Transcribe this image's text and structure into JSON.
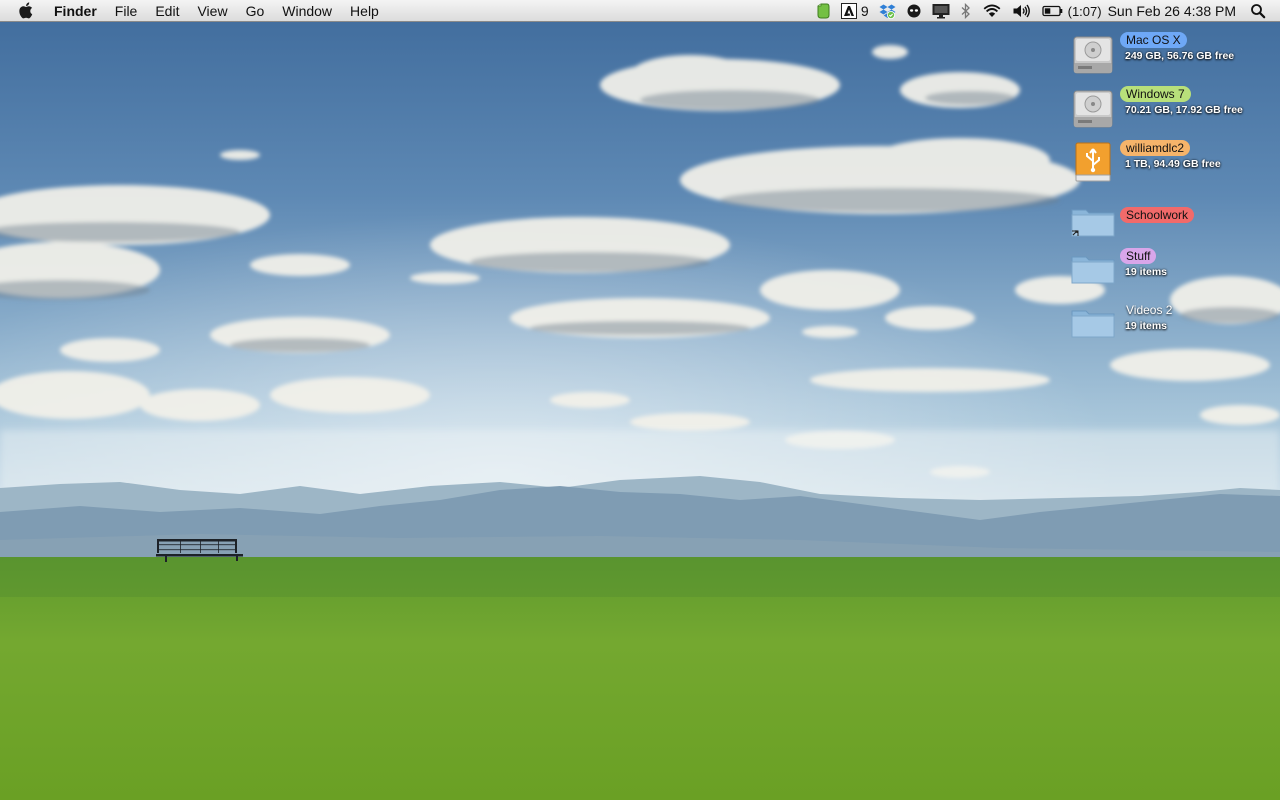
{
  "menubar": {
    "apple_icon": "apple-logo-icon",
    "app_name": "Finder",
    "menus": [
      "File",
      "Edit",
      "View",
      "Go",
      "Window",
      "Help"
    ],
    "status": {
      "evernote_icon": "evernote-icon",
      "adobe_icon": "adobe-updater-icon",
      "adobe_count": "9",
      "dropbox_icon": "dropbox-icon",
      "alien_icon": "alien-app-icon",
      "display_icon": "display-mirroring-icon",
      "bluetooth_icon": "bluetooth-icon",
      "wifi_icon": "wifi-icon",
      "volume_icon": "volume-icon",
      "battery_icon": "battery-icon",
      "battery_time": "(1:07)",
      "clock": "Sun Feb 26  4:38 PM",
      "spotlight_icon": "spotlight-search-icon"
    }
  },
  "desktop": {
    "icons": [
      {
        "name": "Mac OS X",
        "sub": "249 GB, 56.76 GB free",
        "kind": "hard-drive-icon",
        "label_color": "#6ea8f6"
      },
      {
        "name": "Windows 7",
        "sub": "70.21 GB, 17.92 GB free",
        "kind": "hard-drive-icon",
        "label_color": "#b8e07a"
      },
      {
        "name": "williamdlc2",
        "sub": "1 TB, 94.49 GB free",
        "kind": "usb-drive-icon",
        "label_color": "#f6b46a"
      },
      {
        "name": "Schoolwork",
        "sub": "",
        "kind": "folder-alias-icon",
        "label_color": "#f26a6a"
      },
      {
        "name": "Stuff",
        "sub": "19 items",
        "kind": "folder-icon",
        "label_color": "#d9a6ea"
      },
      {
        "name": "Videos 2",
        "sub": "19 items",
        "kind": "folder-icon",
        "label_color": ""
      }
    ]
  },
  "wallpaper": {
    "scene": "wallpaper-field-bench-icon",
    "sky_top": "#4d78a8",
    "sky_horizon": "#d8e6ee",
    "mountains": "#7e9cb2",
    "grass": "#6ea02a"
  }
}
